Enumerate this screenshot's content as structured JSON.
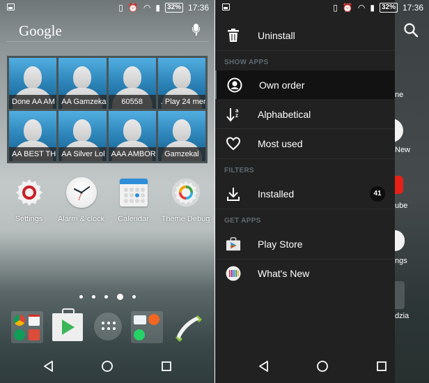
{
  "status_bar": {
    "battery": "32%",
    "time": "17:36",
    "icons": [
      "image-notification-icon",
      "vibrate-icon",
      "alarm-icon",
      "wifi-icon",
      "signal-icon",
      "battery-icon"
    ]
  },
  "home": {
    "search": {
      "logo": "Google",
      "icon": "mic-icon"
    },
    "contacts": [
      {
        "name": "Done AA AM"
      },
      {
        "name": "AA  Gamzeka"
      },
      {
        "name": "60558"
      },
      {
        "name": ". Play 24 mer"
      },
      {
        "name": "AA BEST THI"
      },
      {
        "name": "AA Silver Lol"
      },
      {
        "name": "AAA AMBOR"
      },
      {
        "name": "Gamzekal"
      }
    ],
    "apps": [
      {
        "label": "Settings",
        "icon": "settings-gear-icon"
      },
      {
        "label": "Alarm & clock",
        "icon": "clock-icon"
      },
      {
        "label": "Calendar",
        "icon": "calendar-icon"
      },
      {
        "label": "Theme Debug",
        "icon": "theme-gear-icon"
      }
    ],
    "pages": {
      "count": 5,
      "active_index": 3
    },
    "dock": [
      {
        "name": "google-folder",
        "icons": [
          "chrome-icon",
          "gmail-icon",
          "hangouts-icon",
          "google-plus-icon"
        ]
      },
      {
        "name": "play-store",
        "icon": "play-store-icon"
      },
      {
        "name": "app-drawer",
        "icon": "apps-grid-icon"
      },
      {
        "name": "messaging-folder",
        "icons": [
          "messages-icon",
          "tumblr-icon",
          "whatsapp-icon"
        ]
      },
      {
        "name": "phone",
        "icon": "phone-icon"
      }
    ]
  },
  "drawer": {
    "uninstall_label": "Uninstall",
    "sections": {
      "show_apps": "SHOW APPS",
      "filters": "FILTERS",
      "get_apps": "GET APPS"
    },
    "items": {
      "own_order": "Own order",
      "alphabetical": "Alphabetical",
      "most_used": "Most used",
      "installed": "Installed",
      "installed_count": "41",
      "play_store": "Play Store",
      "whats_new": "What's New"
    },
    "selected": "Own order",
    "behind_labels": [
      "ne",
      "New",
      "ube",
      "ngs",
      "dzia"
    ]
  },
  "colors": {
    "drawer_bg": "#212121",
    "active_row": "#121212",
    "section_header": "#5f6b71",
    "contact_tile": "#2f87bc"
  }
}
